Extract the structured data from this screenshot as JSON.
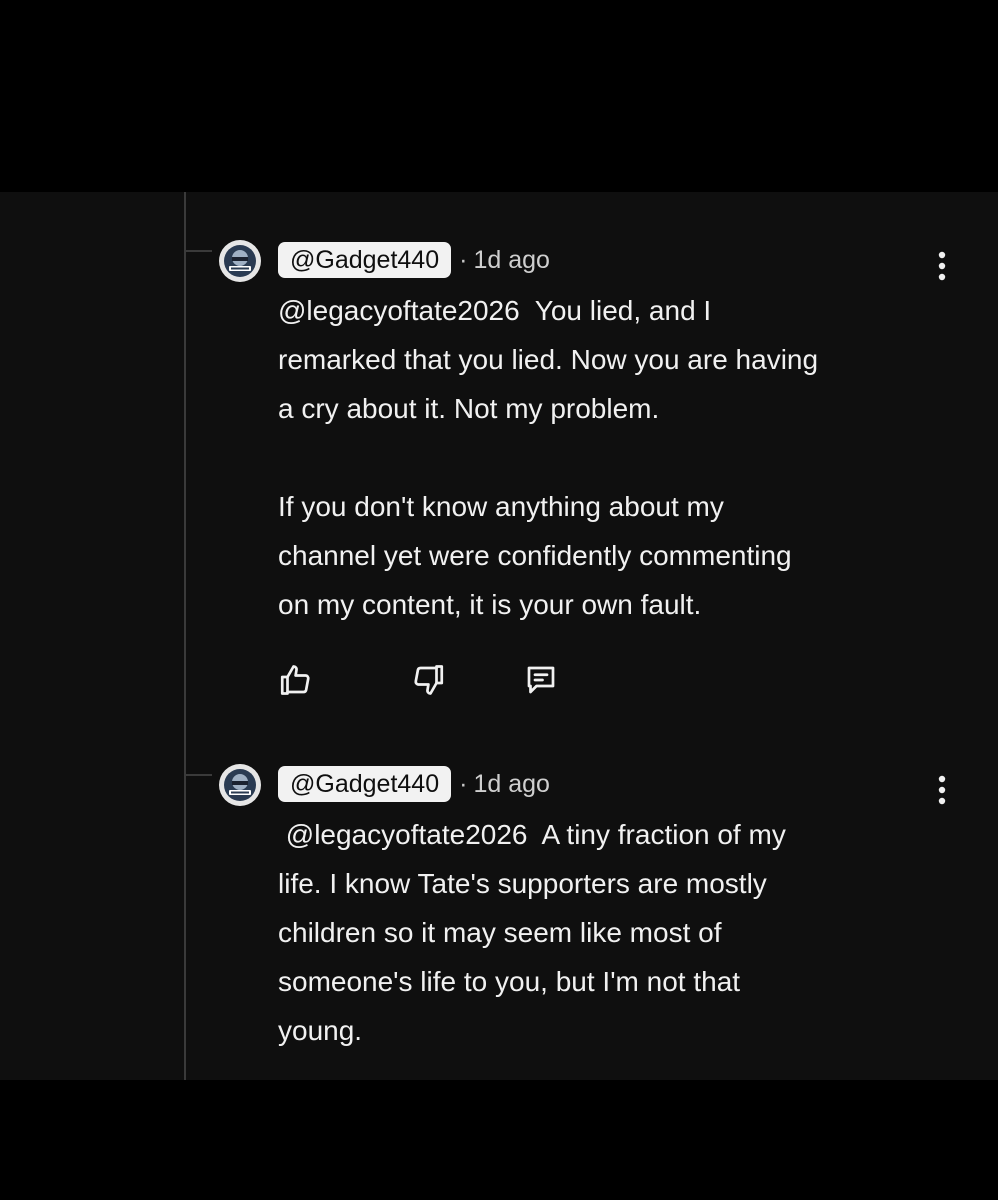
{
  "comments": [
    {
      "author": "@Gadget440",
      "separator": "·",
      "time": "1d ago",
      "avatar_icon": "gadget-channel-avatar",
      "mention": "@legacyoftate2026",
      "text": "@legacyoftate2026  You lied, and I\nremarked that you lied. Now you are having\na cry about it. Not my problem.\n\nIf you don't know anything about my\nchannel yet were confidently commenting\non my content, it is your own fault.",
      "actions": {
        "like_icon": "thumbs-up-icon",
        "dislike_icon": "thumbs-down-icon",
        "reply_icon": "reply-comment-icon"
      }
    },
    {
      "author": "@Gadget440",
      "separator": "·",
      "time": "1d ago",
      "avatar_icon": "gadget-channel-avatar",
      "mention": "@legacyoftate2026",
      "text": " @legacyoftate2026  A tiny fraction of my\nlife. I know Tate's supporters are mostly\nchildren so it may seem like most of\nsomeone's life to you, but I'm not that\nyoung."
    }
  ],
  "colors": {
    "page_background": "#000000",
    "panel_background": "#0f0f0f",
    "text": "#f1f1f1",
    "handle_pill": "#f2f2f2",
    "thread_line": "#3a3a3a"
  }
}
